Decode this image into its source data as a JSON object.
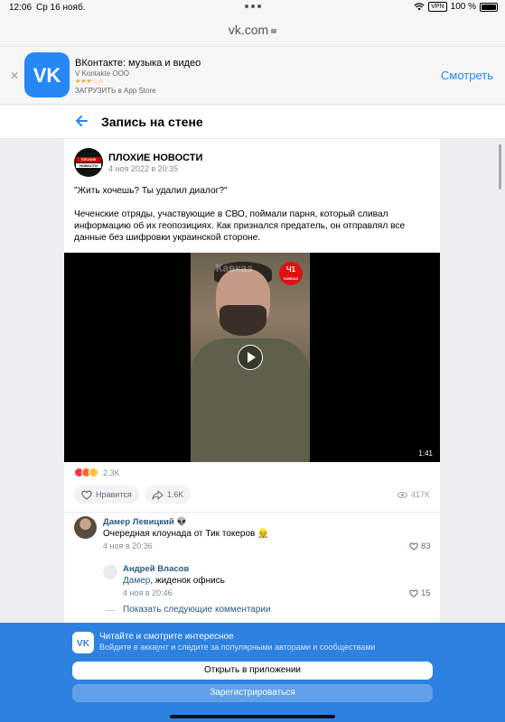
{
  "statusbar": {
    "time": "12:06",
    "date": "Ср 16 нояб.",
    "vpn": "VPN",
    "battery": "100 %"
  },
  "browser": {
    "url": "vk.com"
  },
  "app_banner": {
    "name": "ВКонтакте: музыка и видео",
    "developer": "V Kontakte OOO",
    "stars": "★★★☆☆",
    "store": "ЗАГРУЗИТЬ в App Store",
    "view_label": "Смотреть"
  },
  "header": {
    "title": "Запись на стене"
  },
  "post": {
    "author": "ПЛОХИЕ НОВОСТИ",
    "avatar_line1": "ПЛОХИЕ",
    "avatar_line2": "НОВОСТИ",
    "date": "4 ноя 2022 в 20:35",
    "text_1": "\"Жить хочешь? Ты удалил диалог?\"",
    "text_2": "Чеченские отряды, участвующие в СВО, поймали парня, который сливал информацию об их геопозициях. Как признался предатель, он отправлял все данные без шифровки украинской стороне.",
    "video": {
      "watermark": "Кавказ",
      "badge": "Ч1",
      "badge_sub": "КАВКАЗ",
      "duration": "1:41"
    },
    "reactions_count": "2.3K",
    "like_label": "Нравится",
    "share_count": "1.6K",
    "views": "417K"
  },
  "comments": [
    {
      "name": "Дамер Левицкий 👽",
      "text": "Очередная клоунада от Тик токеров 👷",
      "date": "4 ноя в 20:36",
      "likes": "83"
    },
    {
      "name": "Андрей Власов",
      "reply_to": "Дамер",
      "text": ", жиденок офнись",
      "date": "4 ноя в 20:46",
      "likes": "15"
    }
  ],
  "more_comments": "Показать следующие комментарии",
  "overlay": {
    "heading": "Читайте и смотрите интересное",
    "subheading": "Войдите в аккаунт и следите за популярными авторами и сообществами",
    "open_app": "Открыть в приложении",
    "register": "Зарегистрироваться"
  },
  "colors": {
    "accent": "#2787f5",
    "link": "#2a5885",
    "overlay": "#2d81e0"
  }
}
